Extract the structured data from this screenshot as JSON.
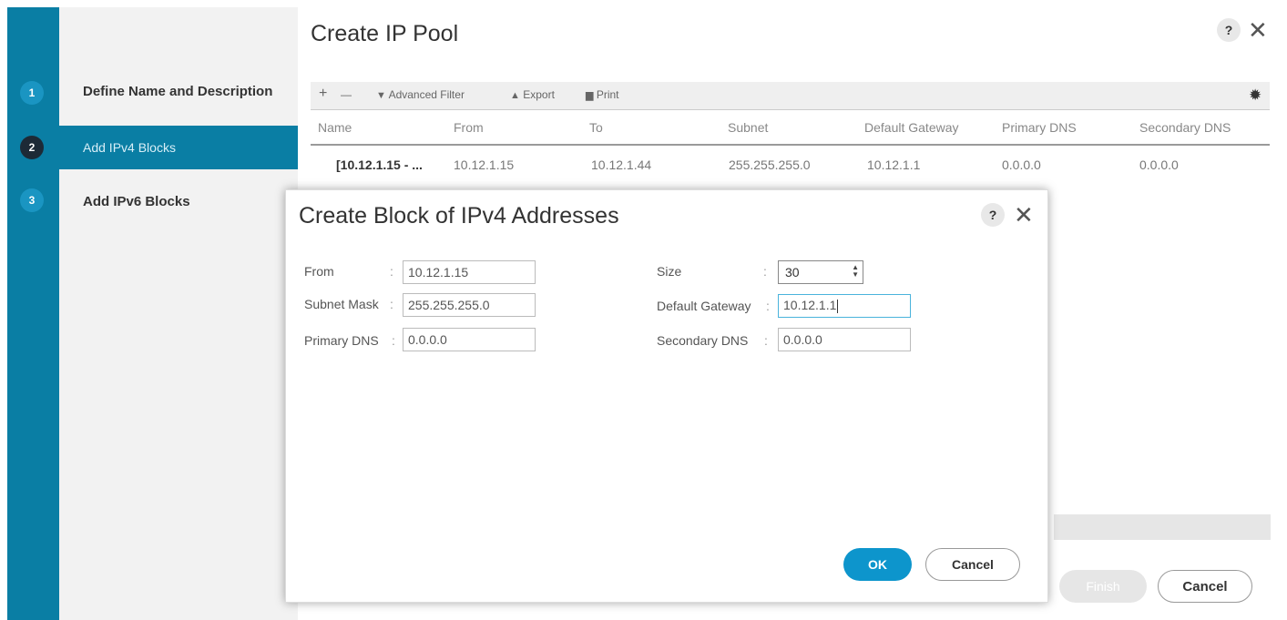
{
  "wizard": {
    "title": "Create IP Pool",
    "help_label": "?",
    "close_label": "✕",
    "steps": [
      {
        "number": "1",
        "label": "Define Name and Description",
        "state": "done"
      },
      {
        "number": "2",
        "label": "Add IPv4 Blocks",
        "state": "active"
      },
      {
        "number": "3",
        "label": "Add IPv6 Blocks",
        "state": "todo"
      }
    ],
    "toolbar": {
      "add_label": "+",
      "remove_label": "—",
      "filter_label": "Advanced Filter",
      "export_label": "Export",
      "print_label": "Print",
      "settings_icon": "gear-icon"
    },
    "table": {
      "columns": [
        "Name",
        "From",
        "To",
        "Subnet",
        "Default Gateway",
        "Primary DNS",
        "Secondary DNS"
      ],
      "rows": [
        [
          "[10.12.1.15 - ...",
          "10.12.1.15",
          "10.12.1.44",
          "255.255.255.0",
          "10.12.1.1",
          "0.0.0.0",
          "0.0.0.0"
        ]
      ]
    },
    "finish_label": "Finish",
    "cancel_label": "Cancel"
  },
  "modal": {
    "title": "Create Block of IPv4 Addresses",
    "help_label": "?",
    "close_label": "✕",
    "fields": {
      "from": {
        "label": "From",
        "value": "10.12.1.15"
      },
      "subnet_mask": {
        "label": "Subnet Mask",
        "value": "255.255.255.0"
      },
      "primary_dns": {
        "label": "Primary DNS",
        "value": "0.0.0.0"
      },
      "size": {
        "label": "Size",
        "value": "30"
      },
      "default_gateway": {
        "label": "Default Gateway",
        "value": "10.12.1.1"
      },
      "secondary_dns": {
        "label": "Secondary DNS",
        "value": "0.0.0.0"
      }
    },
    "colon": ":",
    "ok_label": "OK",
    "cancel_label": "Cancel"
  },
  "colors": {
    "accent": "#0a7ea4",
    "ok_button": "#0d95cc",
    "active_step_number": "#1d2a36"
  }
}
